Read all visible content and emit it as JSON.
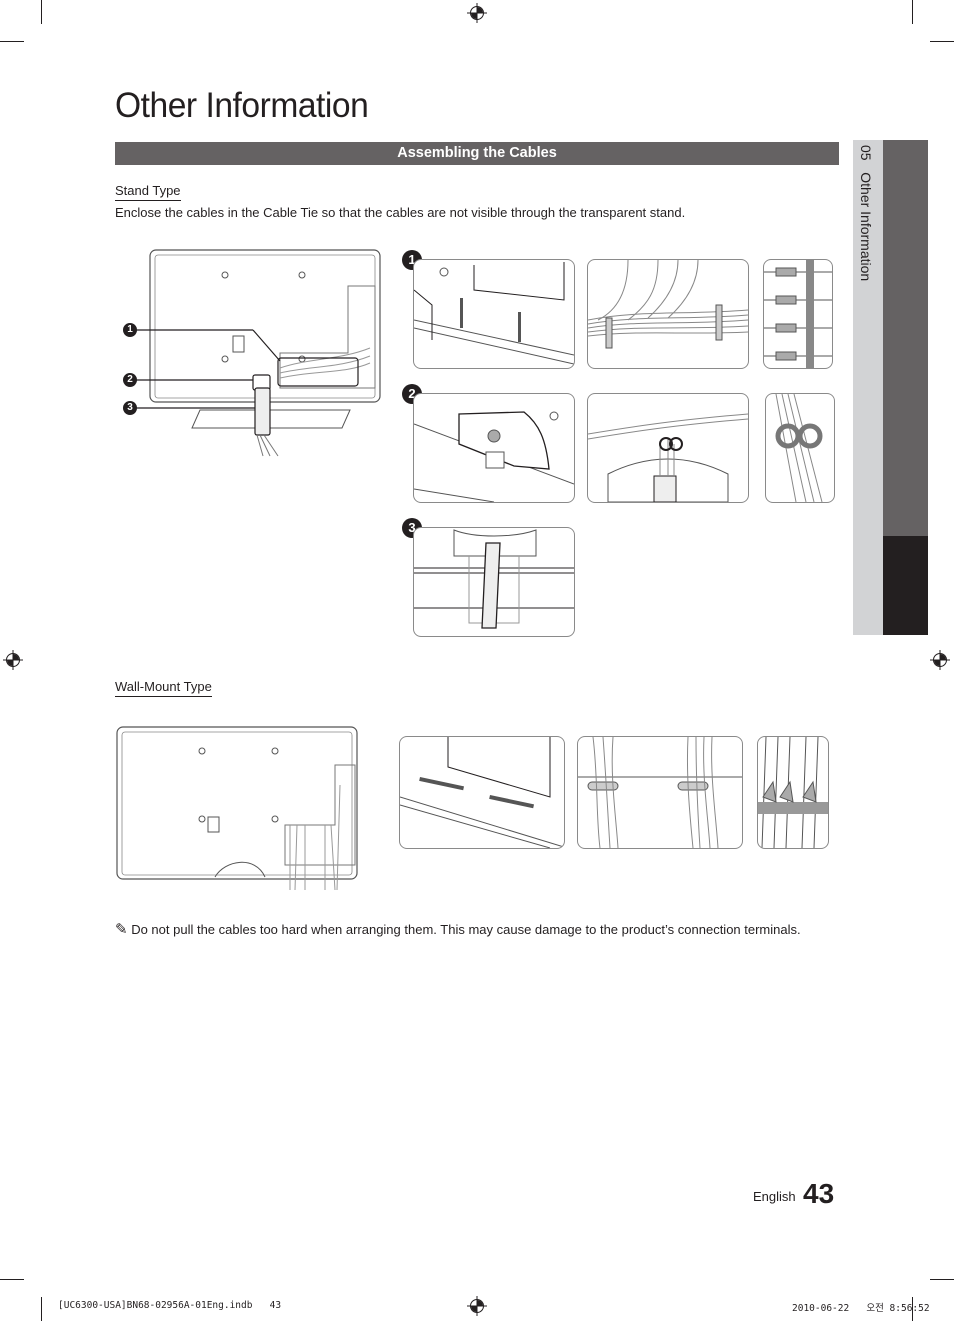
{
  "page": {
    "title": "Other Information",
    "section_header": "Assembling the Cables",
    "side_tab": {
      "chapter_number": "05",
      "chapter_title": "Other Information"
    }
  },
  "stand_type": {
    "heading": "Stand Type",
    "description": "Enclose the cables in the Cable Tie so that the cables are not visible through the transparent stand.",
    "overview_callouts": [
      "1",
      "2",
      "3"
    ],
    "steps": [
      {
        "number": "1",
        "panels": [
          "tv-back-slot-closeup",
          "cables-in-clips",
          "clip-detail"
        ]
      },
      {
        "number": "2",
        "panels": [
          "stand-neck-closeup",
          "cable-ring-holder",
          "ring-detail"
        ]
      },
      {
        "number": "3",
        "panels": [
          "cable-tie-through-stand"
        ]
      }
    ]
  },
  "wall_mount_type": {
    "heading": "Wall-Mount Type",
    "panels": [
      "tv-back-slot-closeup",
      "cables-in-clips",
      "clip-detail"
    ]
  },
  "note": {
    "icon": "pencil-note-icon",
    "text": "Do not pull the cables too hard when arranging them. This may cause damage to the product’s connection terminals."
  },
  "footer": {
    "language": "English",
    "page_number": "43",
    "slug_file": "[UC6300-USA]BN68-02956A-01Eng.indb   43",
    "slug_date": "2010-06-22   오전 8:56:52"
  },
  "colors": {
    "section_bar": "#656263",
    "tab_light": "#d2d3d5",
    "tab_dark": "#656263",
    "tab_black": "#231f20",
    "text": "#231f20"
  }
}
